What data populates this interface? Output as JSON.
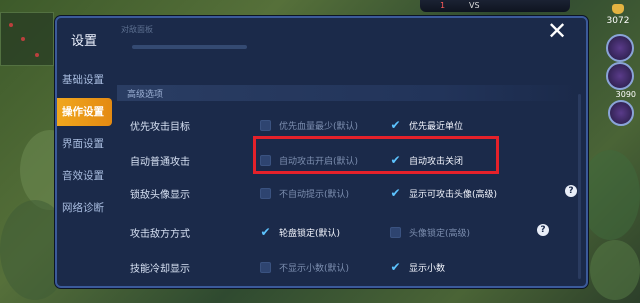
{
  "hud": {
    "kill_left": "1",
    "vs": "VS",
    "gold": "3072",
    "skill_num": "3090"
  },
  "panel": {
    "title": "设置",
    "close_symbol": "✕",
    "faint_text": "对敌面板"
  },
  "sidebar": {
    "items": [
      {
        "label": "基础设置",
        "active": false
      },
      {
        "label": "操作设置",
        "active": true
      },
      {
        "label": "界面设置",
        "active": false
      },
      {
        "label": "音效设置",
        "active": false
      },
      {
        "label": "网络诊断",
        "active": false
      }
    ]
  },
  "section": {
    "title": "高级选项"
  },
  "rows": [
    {
      "label": "优先攻击目标",
      "opt1": "优先血量最少(默认)",
      "opt1_on": false,
      "opt2": "优先最近单位",
      "opt2_on": true
    },
    {
      "label": "自动普通攻击",
      "opt1": "自动攻击开启(默认)",
      "opt1_on": false,
      "opt2": "自动攻击关闭",
      "opt2_on": true
    },
    {
      "label": "锁敌头像显示",
      "opt1": "不自动提示(默认)",
      "opt1_on": false,
      "opt2": "显示可攻击头像(高级)",
      "opt2_on": true,
      "help": "?"
    },
    {
      "label": "攻击敌方方式",
      "opt1": "轮盘锁定(默认)",
      "opt1_on": true,
      "opt2": "头像锁定(高级)",
      "opt2_on": false,
      "help": "?"
    },
    {
      "label": "技能冷却显示",
      "opt1": "不显示小数(默认)",
      "opt1_on": false,
      "opt2": "显示小数",
      "opt2_on": true
    }
  ],
  "colors": {
    "accent": "#f0a71e",
    "check": "#5dc4ff",
    "highlight": "#e5212a",
    "panel": "#1b2a4a"
  }
}
